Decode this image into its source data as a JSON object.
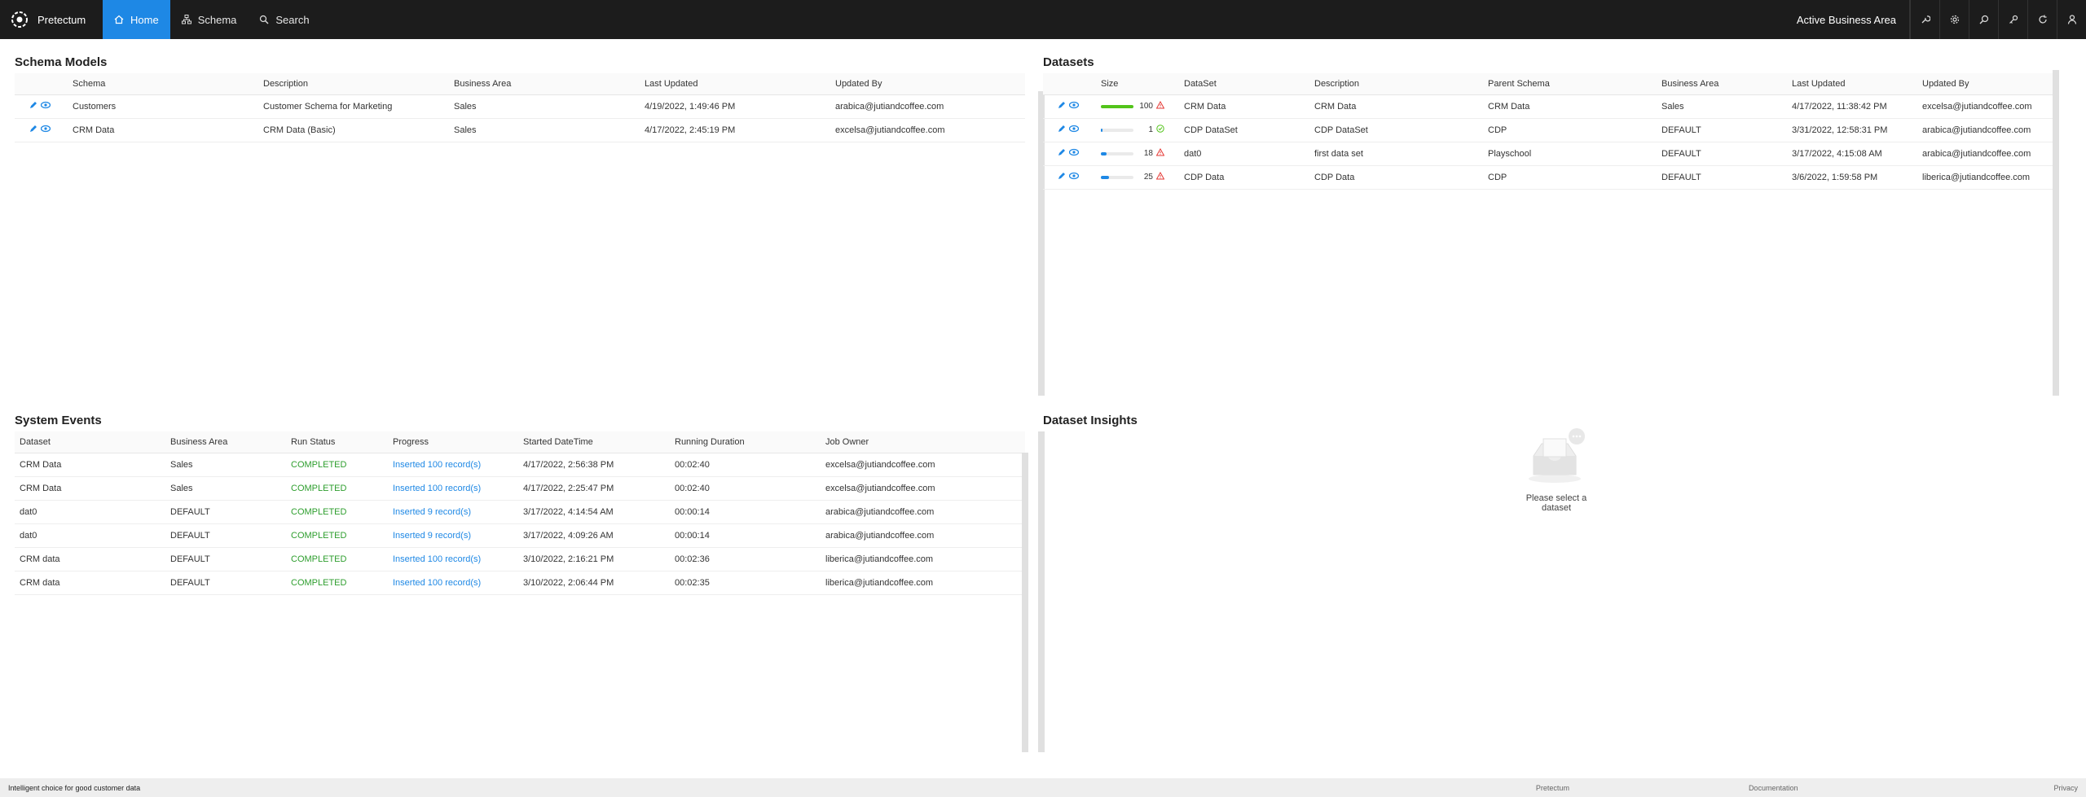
{
  "app": {
    "name": "Pretectum",
    "nav": [
      {
        "label": "Home",
        "icon": "home-icon",
        "active": true
      },
      {
        "label": "Schema",
        "icon": "schema-icon",
        "active": false
      },
      {
        "label": "Search",
        "icon": "search-icon",
        "active": false
      }
    ],
    "active_area_label": "Active Business Area"
  },
  "schema_models": {
    "title": "Schema Models",
    "headers": [
      "Schema",
      "Description",
      "Business Area",
      "Last Updated",
      "Updated By"
    ],
    "rows": [
      [
        "Customers",
        "Customer Schema for Marketing",
        "Sales",
        "4/19/2022, 1:49:46 PM",
        "arabica@jutiandcoffee.com"
      ],
      [
        "CRM Data",
        "CRM Data (Basic)",
        "Sales",
        "4/17/2022, 2:45:19 PM",
        "excelsa@jutiandcoffee.com"
      ]
    ]
  },
  "datasets": {
    "title": "Datasets",
    "headers": [
      "Size",
      "DataSet",
      "Description",
      "Parent Schema",
      "Business Area",
      "Last Updated",
      "Updated By"
    ],
    "rows": [
      {
        "size": "100",
        "fill": 1.0,
        "bar_color": "#52c41a",
        "status": "warning",
        "cells": [
          "CRM Data",
          "CRM Data",
          "CRM Data",
          "Sales",
          "4/17/2022, 11:38:42 PM",
          "excelsa@jutiandcoffee.com"
        ]
      },
      {
        "size": "1",
        "fill": 0.01,
        "bar_color": "#1e88e5",
        "status": "ok",
        "cells": [
          "CDP DataSet",
          "CDP DataSet",
          "CDP",
          "DEFAULT",
          "3/31/2022, 12:58:31 PM",
          "arabica@jutiandcoffee.com"
        ]
      },
      {
        "size": "18",
        "fill": 0.18,
        "bar_color": "#1e88e5",
        "status": "warning",
        "cells": [
          "dat0",
          "first data set",
          "Playschool",
          "DEFAULT",
          "3/17/2022, 4:15:08 AM",
          "arabica@jutiandcoffee.com"
        ]
      },
      {
        "size": "25",
        "fill": 0.25,
        "bar_color": "#1e88e5",
        "status": "warning",
        "cells": [
          "CDP Data",
          "CDP Data",
          "CDP",
          "DEFAULT",
          "3/6/2022, 1:59:58 PM",
          "liberica@jutiandcoffee.com"
        ]
      }
    ]
  },
  "system_events": {
    "title": "System Events",
    "headers": [
      "Dataset",
      "Business Area",
      "Run Status",
      "Progress",
      "Started DateTime",
      "Running Duration",
      "Job Owner"
    ],
    "rows": [
      [
        "CRM Data",
        "Sales",
        "COMPLETED",
        "Inserted 100 record(s)",
        "4/17/2022, 2:56:38 PM",
        "00:02:40",
        "excelsa@jutiandcoffee.com"
      ],
      [
        "CRM Data",
        "Sales",
        "COMPLETED",
        "Inserted 100 record(s)",
        "4/17/2022, 2:25:47 PM",
        "00:02:40",
        "excelsa@jutiandcoffee.com"
      ],
      [
        "dat0",
        "DEFAULT",
        "COMPLETED",
        "Inserted 9 record(s)",
        "3/17/2022, 4:14:54 AM",
        "00:00:14",
        "arabica@jutiandcoffee.com"
      ],
      [
        "dat0",
        "DEFAULT",
        "COMPLETED",
        "Inserted 9 record(s)",
        "3/17/2022, 4:09:26 AM",
        "00:00:14",
        "arabica@jutiandcoffee.com"
      ],
      [
        "CRM data",
        "DEFAULT",
        "COMPLETED",
        "Inserted 100 record(s)",
        "3/10/2022, 2:16:21 PM",
        "00:02:36",
        "liberica@jutiandcoffee.com"
      ],
      [
        "CRM data",
        "DEFAULT",
        "COMPLETED",
        "Inserted 100 record(s)",
        "3/10/2022, 2:06:44 PM",
        "00:02:35",
        "liberica@jutiandcoffee.com"
      ]
    ]
  },
  "dataset_insights": {
    "title": "Dataset Insights",
    "empty_text": "Please select a dataset"
  },
  "footer": {
    "tagline": "Intelligent choice for good customer data",
    "links": [
      "Pretectum",
      "Documentation",
      "Privacy"
    ]
  },
  "colors": {
    "nav_active": "#1e88e5",
    "topbar": "#1c1c1c",
    "completed": "#2e9e2e",
    "link": "#1e88e5",
    "warning": "#e53935",
    "ok": "#52c41a"
  }
}
